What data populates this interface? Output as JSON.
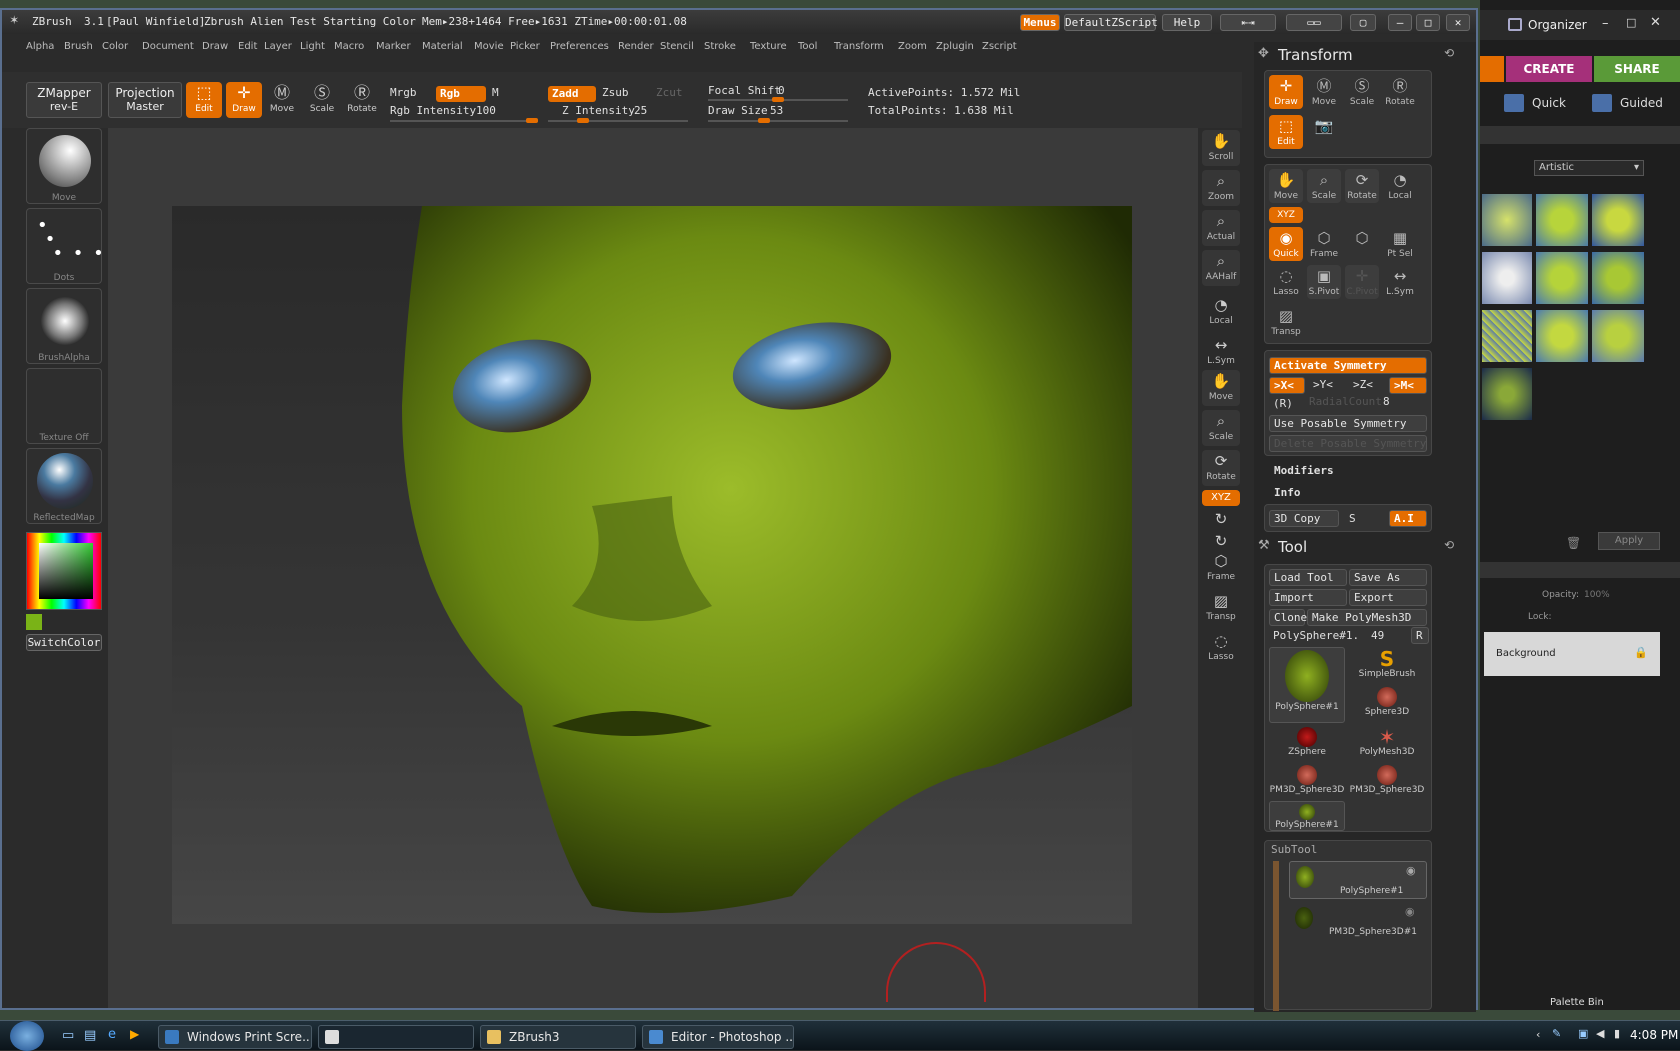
{
  "titlebar": {
    "app": "ZBrush",
    "version": "3.1",
    "user": "[Paul Winfield]",
    "doc": "Zbrush Alien Test Starting Color",
    "mem": "Mem▸238+1464 Free▸1631 ZTime▸00:00:01.08",
    "menus_btn": "Menus",
    "script_btn": "DefaultZScript",
    "help_btn": "Help"
  },
  "menus": [
    "Alpha",
    "Brush",
    "Color",
    "Document",
    "Draw",
    "Edit",
    "Layer",
    "Light",
    "Macro",
    "Marker",
    "Material",
    "Movie",
    "Picker",
    "Preferences",
    "Render",
    "Stencil",
    "Stroke",
    "Texture",
    "Tool",
    "Transform",
    "Zoom",
    "Zplugin",
    "Zscript"
  ],
  "shelf": {
    "zmapper": "ZMapper",
    "zmapper_sub": "rev-E",
    "projection": "Projection",
    "projection_sub": "Master",
    "edit": "Edit",
    "draw": "Draw",
    "move": "Move",
    "scale": "Scale",
    "rotate": "Rotate",
    "mrgb": "Mrgb",
    "rgb": "Rgb",
    "m": "M",
    "rgb_intensity_label": "Rgb Intensity",
    "rgb_intensity": "100",
    "zadd": "Zadd",
    "zsub": "Zsub",
    "zcut": "Zcut",
    "z_intensity_label": "Z Intensity",
    "z_intensity": "25",
    "focal_label": "Focal Shift",
    "focal": "0",
    "draw_size_label": "Draw Size",
    "draw_size": "53",
    "active_points": "ActivePoints: 1.572 Mil",
    "total_points": "TotalPoints: 1.638 Mil",
    "rgb_intensity_pct": 1.0,
    "z_intensity_pct": 0.25,
    "focal_pct": 0.5,
    "draw_size_pct": 0.4
  },
  "left_tray": {
    "move": "Move",
    "dots": "Dots",
    "brush_alpha": "BrushAlpha",
    "texture": "Texture Off",
    "material": "ReflectedMap",
    "switch_color": "SwitchColor",
    "main_color": "#7ab317"
  },
  "right_shelf": [
    "Scroll",
    "Zoom",
    "Actual",
    "AAHalf",
    "Local",
    "L.Sym",
    "Move",
    "Scale",
    "Rotate",
    "XYZ",
    "Frame",
    "Transp",
    "Lasso"
  ],
  "transform": {
    "title": "Transform",
    "draw": "Draw",
    "move": "Move",
    "scale": "Scale",
    "rotate": "Rotate",
    "edit": "Edit",
    "move2": "Move",
    "scale2": "Scale",
    "rotate2": "Rotate",
    "local": "Local",
    "xyz": "XYZ",
    "quick": "Quick",
    "frame": "Frame",
    "ptsel": "Pt Sel",
    "lasso": "Lasso",
    "spivot": "S.Pivot",
    "cpivot": "C.Pivot",
    "lsym": "L.Sym",
    "transp": "Transp",
    "activate_symmetry": "Activate Symmetry",
    "sx": ">X<",
    "sy": ">Y<",
    "sz": ">Z<",
    "sm": ">M<",
    "r": "(R)",
    "radial_count": "RadialCount",
    "radial_val": "8",
    "use_posable": "Use Posable Symmetry",
    "delete_posable": "Delete Posable Symmetry",
    "modifiers": "Modifiers",
    "info": "Info",
    "copy3d": "3D Copy",
    "s": "S",
    "ai": "A.I"
  },
  "tool": {
    "title": "Tool",
    "load": "Load Tool",
    "save_as": "Save As",
    "import": "Import",
    "export": "Export",
    "clone": "Clone",
    "make_poly": "Make PolyMesh3D",
    "current": "PolySphere#1.",
    "current_val": "49",
    "r": "R",
    "items": [
      "PolySphere#1",
      "SimpleBrush",
      "Sphere3D",
      "ZSphere",
      "PolyMesh3D",
      "PM3D_Sphere3D",
      "PM3D_Sphere3D",
      "PolySphere#1"
    ],
    "subtool": "SubTool",
    "subtools": [
      "PolySphere#1",
      "PM3D_Sphere3D#1"
    ]
  },
  "photoshop": {
    "organizer": "Organizer",
    "create": "CREATE",
    "share": "SHARE",
    "quick": "Quick",
    "guided": "Guided",
    "artistic": "Artistic",
    "apply": "Apply",
    "opacity": "Opacity:",
    "opacity_val": "100%",
    "lock": "Lock:",
    "background": "Background",
    "palette_bin": "Palette Bin"
  },
  "taskbar": {
    "items": [
      "Windows Print Scre...",
      "",
      "ZBrush3",
      "Editor - Photoshop ..."
    ],
    "time": "4:08 PM"
  }
}
